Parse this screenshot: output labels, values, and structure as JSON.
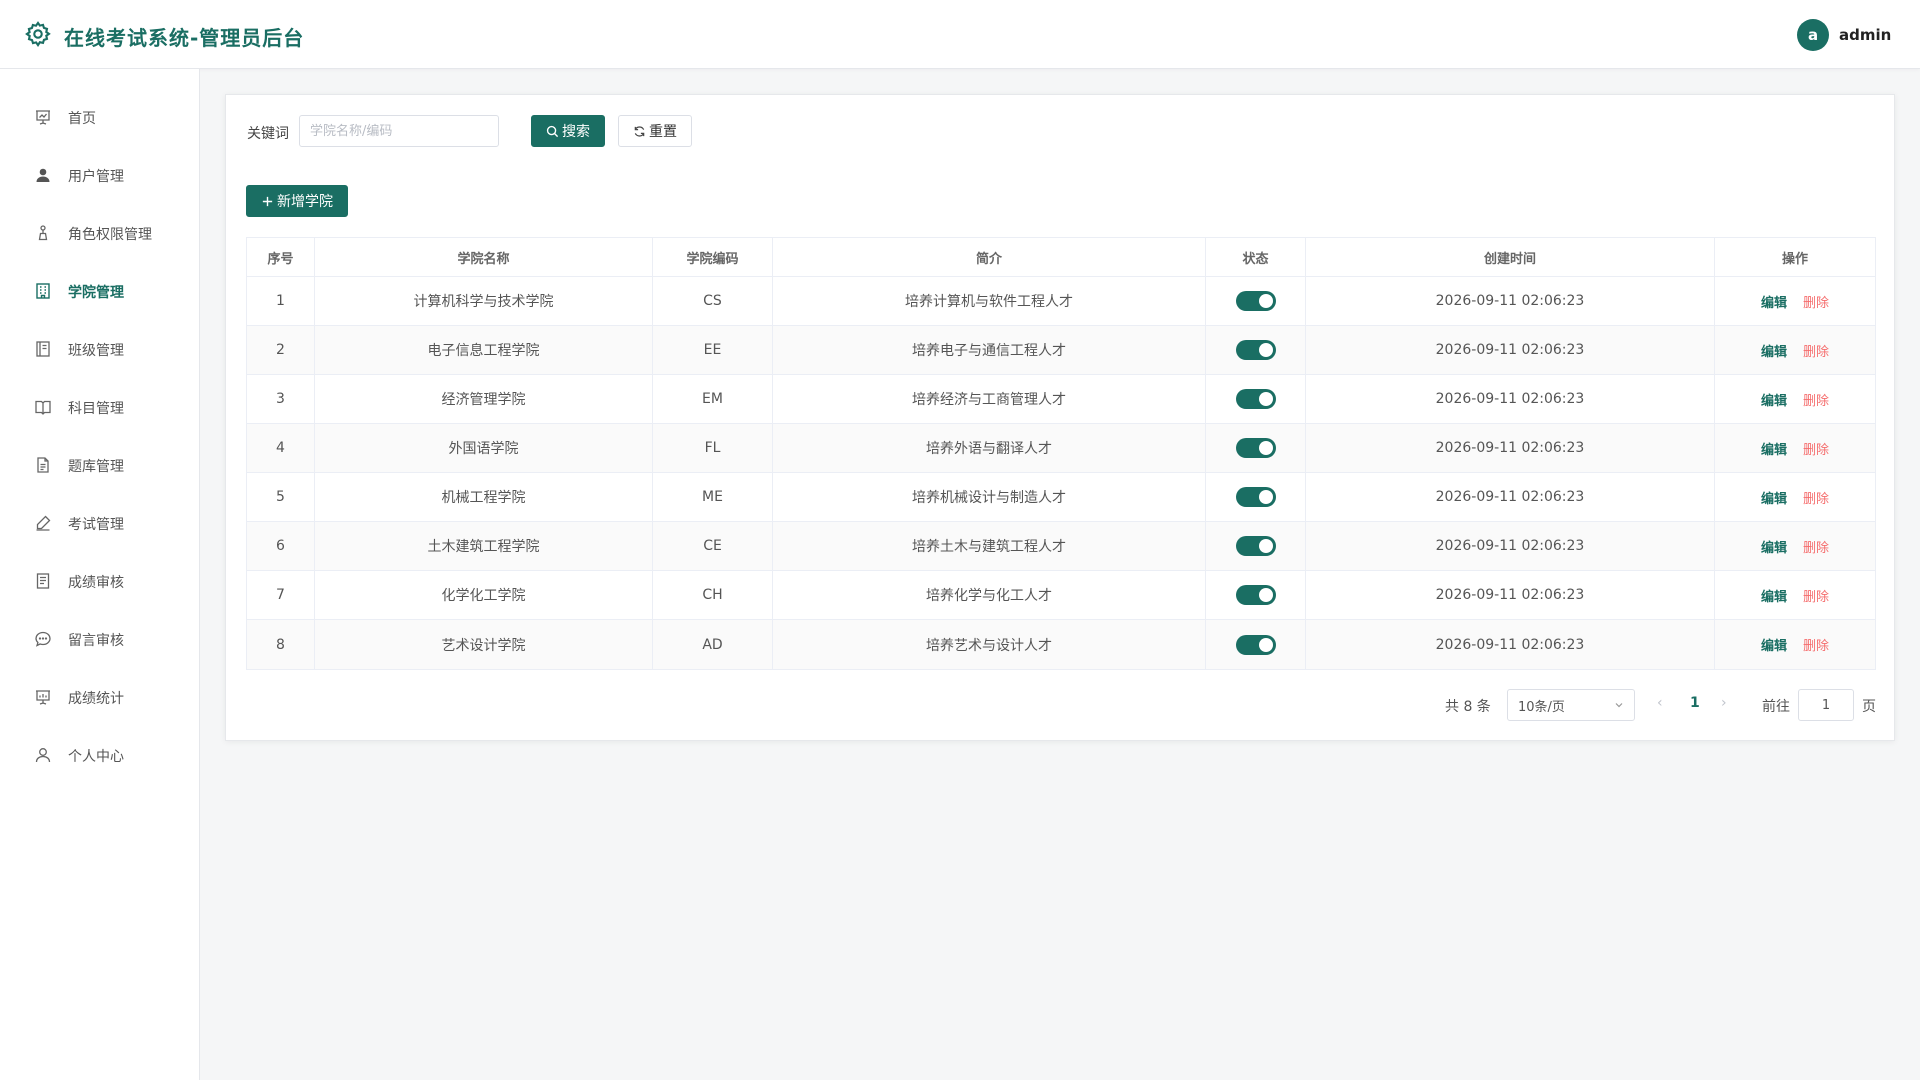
{
  "header": {
    "title": "在线考试系统-管理员后台",
    "logo_icon": "gear-icon",
    "user_initial": "a",
    "username": "admin",
    "brand_color": "#1a6e63"
  },
  "sidebar": {
    "items": [
      {
        "label": "首页",
        "icon": "presentation-chart-icon"
      },
      {
        "label": "用户管理",
        "icon": "user-filled-icon"
      },
      {
        "label": "角色权限管理",
        "icon": "stamp-icon"
      },
      {
        "label": "学院管理",
        "icon": "building-icon",
        "active": true
      },
      {
        "label": "班级管理",
        "icon": "notebook-icon"
      },
      {
        "label": "科目管理",
        "icon": "open-book-icon"
      },
      {
        "label": "题库管理",
        "icon": "document-icon"
      },
      {
        "label": "考试管理",
        "icon": "pen-icon"
      },
      {
        "label": "成绩审核",
        "icon": "tickets-icon"
      },
      {
        "label": "留言审核",
        "icon": "chat-dots-icon"
      },
      {
        "label": "成绩统计",
        "icon": "data-board-icon"
      },
      {
        "label": "个人中心",
        "icon": "user-outline-icon"
      }
    ]
  },
  "search": {
    "label": "关键词",
    "placeholder": "学院名称/编码",
    "value": "",
    "search_button": "搜索",
    "reset_button": "重置"
  },
  "add_button": "新增学院",
  "table": {
    "columns": [
      "序号",
      "学院名称",
      "学院编码",
      "简介",
      "状态",
      "创建时间",
      "操作"
    ],
    "rows": [
      {
        "index": "1",
        "name": "计算机科学与技术学院",
        "code": "CS",
        "intro": "培养计算机与软件工程人才",
        "enabled": true,
        "created": "2026-09-11 02:06:23"
      },
      {
        "index": "2",
        "name": "电子信息工程学院",
        "code": "EE",
        "intro": "培养电子与通信工程人才",
        "enabled": true,
        "created": "2026-09-11 02:06:23"
      },
      {
        "index": "3",
        "name": "经济管理学院",
        "code": "EM",
        "intro": "培养经济与工商管理人才",
        "enabled": true,
        "created": "2026-09-11 02:06:23"
      },
      {
        "index": "4",
        "name": "外国语学院",
        "code": "FL",
        "intro": "培养外语与翻译人才",
        "enabled": true,
        "created": "2026-09-11 02:06:23"
      },
      {
        "index": "5",
        "name": "机械工程学院",
        "code": "ME",
        "intro": "培养机械设计与制造人才",
        "enabled": true,
        "created": "2026-09-11 02:06:23"
      },
      {
        "index": "6",
        "name": "土木建筑工程学院",
        "code": "CE",
        "intro": "培养土木与建筑工程人才",
        "enabled": true,
        "created": "2026-09-11 02:06:23"
      },
      {
        "index": "7",
        "name": "化学化工学院",
        "code": "CH",
        "intro": "培养化学与化工人才",
        "enabled": true,
        "created": "2026-09-11 02:06:23"
      },
      {
        "index": "8",
        "name": "艺术设计学院",
        "code": "AD",
        "intro": "培养艺术与设计人才",
        "enabled": true,
        "created": "2026-09-11 02:06:23"
      }
    ],
    "edit_label": "编辑",
    "delete_label": "删除"
  },
  "pagination": {
    "total_text": "共 8 条",
    "page_size": "10条/页",
    "current_page": "1",
    "goto_label": "前往",
    "goto_value": "1",
    "page_unit": "页"
  }
}
